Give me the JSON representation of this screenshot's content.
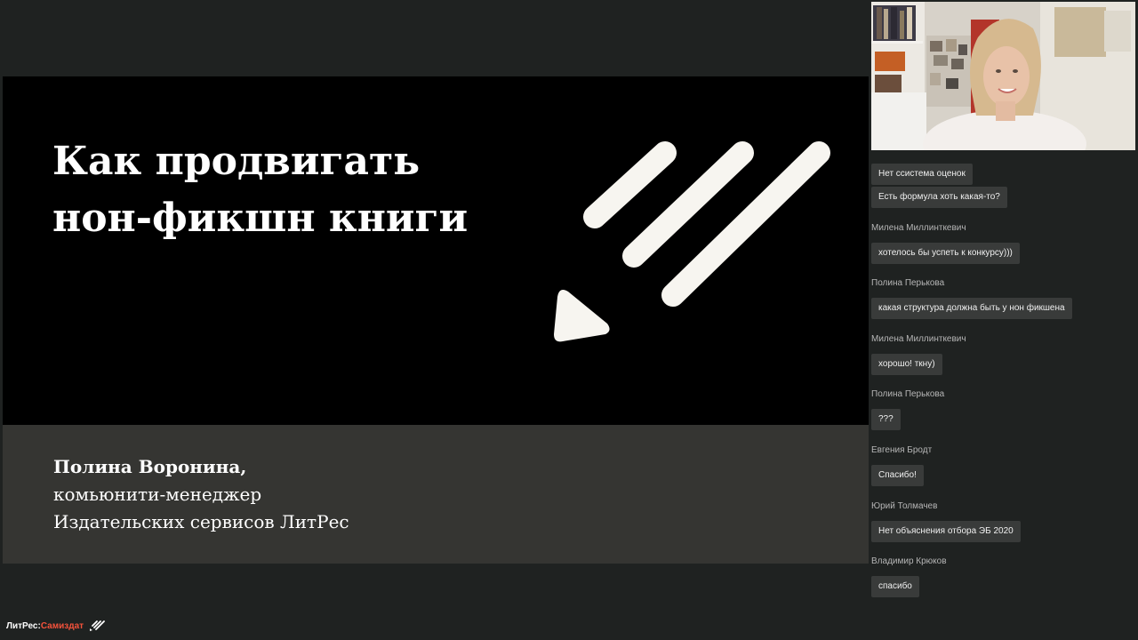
{
  "slide": {
    "title_lines": [
      "Как продвигать",
      "нон-фикшн книги"
    ],
    "speaker_name": "Полина Воронина,",
    "speaker_role": "комьюнити-менеджер",
    "speaker_org": "Издательских сервисов ЛитРес",
    "colors": {
      "top": "#000000",
      "bottom": "#353532"
    }
  },
  "chat": {
    "messages": [
      {
        "author": "",
        "text": "Нет ссистема оценок"
      },
      {
        "author": "",
        "text": "Есть формула хоть какая-то?"
      },
      {
        "author": "Милена Миллинткевич",
        "text": "хотелось бы успеть к конкурсу)))"
      },
      {
        "author": "Полина Перькова",
        "text": "какая структура должна  быть у нон фикшена"
      },
      {
        "author": "Милена Миллинткевич",
        "text": "хорошо! ткну)"
      },
      {
        "author": "Полина Перькова",
        "text": "???"
      },
      {
        "author": "Евгения Бродт",
        "text": "Спасибо!"
      },
      {
        "author": "Юрий Толмачев",
        "text": "Нет объяснения отбора ЭБ 2020"
      },
      {
        "author": "Владимир Крюков",
        "text": "спасибо"
      }
    ]
  },
  "watermark": {
    "brand": "ЛитРес:",
    "sub": "Самиздат",
    "icon": "pencil-stripes-icon"
  },
  "webcam": {
    "icon": "presenter-video"
  }
}
